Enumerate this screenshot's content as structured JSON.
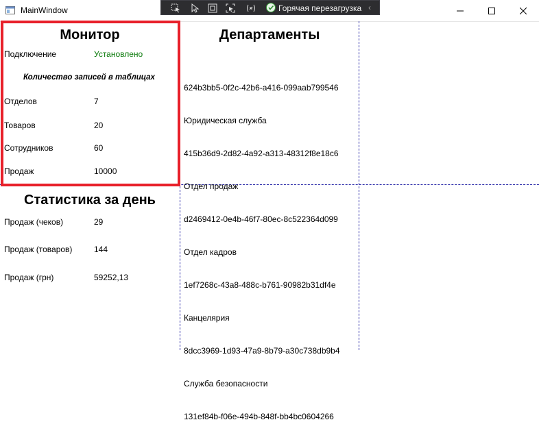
{
  "window": {
    "title": "MainWindow",
    "controls": [
      "minimize-icon",
      "maximize-icon",
      "close-icon"
    ]
  },
  "dev_toolbar": {
    "tools": [
      "select-element-icon",
      "pointer-icon",
      "display-layout-adorners-icon",
      "track-focus-icon",
      "binding-failures-icon"
    ],
    "hot_reload_label": "Горячая перезагрузка",
    "status_color": "#3a9a3a"
  },
  "monitor": {
    "title": "Монитор",
    "connection_label": "Подключение",
    "connection_value": "Установлено",
    "connection_color": "#0a7a0a",
    "tables_heading": "Количество записей в таблицах",
    "rows": [
      {
        "label": "Отделов",
        "value": "7"
      },
      {
        "label": "Товаров",
        "value": "20"
      },
      {
        "label": "Сотрудников",
        "value": "60"
      },
      {
        "label": "Продаж",
        "value": "10000"
      }
    ]
  },
  "departments": {
    "title": "Департаменты",
    "items": [
      {
        "id": "624b3bb5-0f2c-42b6-a416-099aab799546",
        "name": "Юридическая служба"
      },
      {
        "id": "415b36d9-2d82-4a92-a313-48312f8e18c6",
        "name": "Отдел продаж"
      },
      {
        "id": "d2469412-0e4b-46f7-80ec-8c522364d099",
        "name": "Отдел кадров"
      },
      {
        "id": "1ef7268c-43a8-488c-b761-90982b31df4e",
        "name": "Канцелярия"
      },
      {
        "id": "8dcc3969-1d93-47a9-8b79-a30c738db9b4",
        "name": "Служба безопасности"
      },
      {
        "id": "131ef84b-f06e-494b-848f-bb4bc0604266",
        "name": ""
      }
    ]
  },
  "stats": {
    "title": "Статистика за день",
    "rows": [
      {
        "label": "Продаж (чеков)",
        "value": "29"
      },
      {
        "label": "Продаж (товаров)",
        "value": "144"
      },
      {
        "label": "Продаж (грн)",
        "value": "59252,13"
      }
    ]
  },
  "colors": {
    "highlight_border": "#e8202a",
    "grid_lines": "#2a2aa8"
  }
}
